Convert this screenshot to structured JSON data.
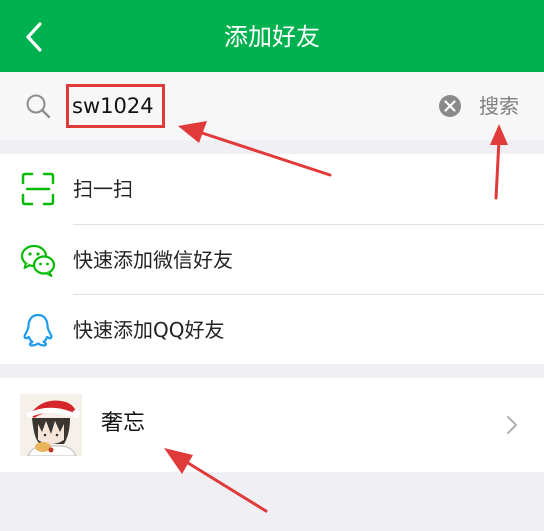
{
  "header": {
    "title": "添加好友",
    "back_icon": "chevron-left-icon"
  },
  "search": {
    "value": "sw1024",
    "search_label": "搜索",
    "search_icon": "search-icon",
    "clear_icon": "clear-icon"
  },
  "menu": {
    "items": [
      {
        "label": "扫一扫",
        "icon": "scan-icon"
      },
      {
        "label": "快速添加微信好友",
        "icon": "wechat-icon"
      },
      {
        "label": "快速添加QQ好友",
        "icon": "qq-icon"
      }
    ]
  },
  "result": {
    "name": "奢忘",
    "avatar_icon": "avatar",
    "chevron_icon": "chevron-right-icon"
  },
  "colors": {
    "header_bg": "#00b14f",
    "accent_green": "#09bb07",
    "qq_blue": "#1e9bf0",
    "annotation_red": "#e03a3a",
    "page_bg": "#efeff4"
  }
}
